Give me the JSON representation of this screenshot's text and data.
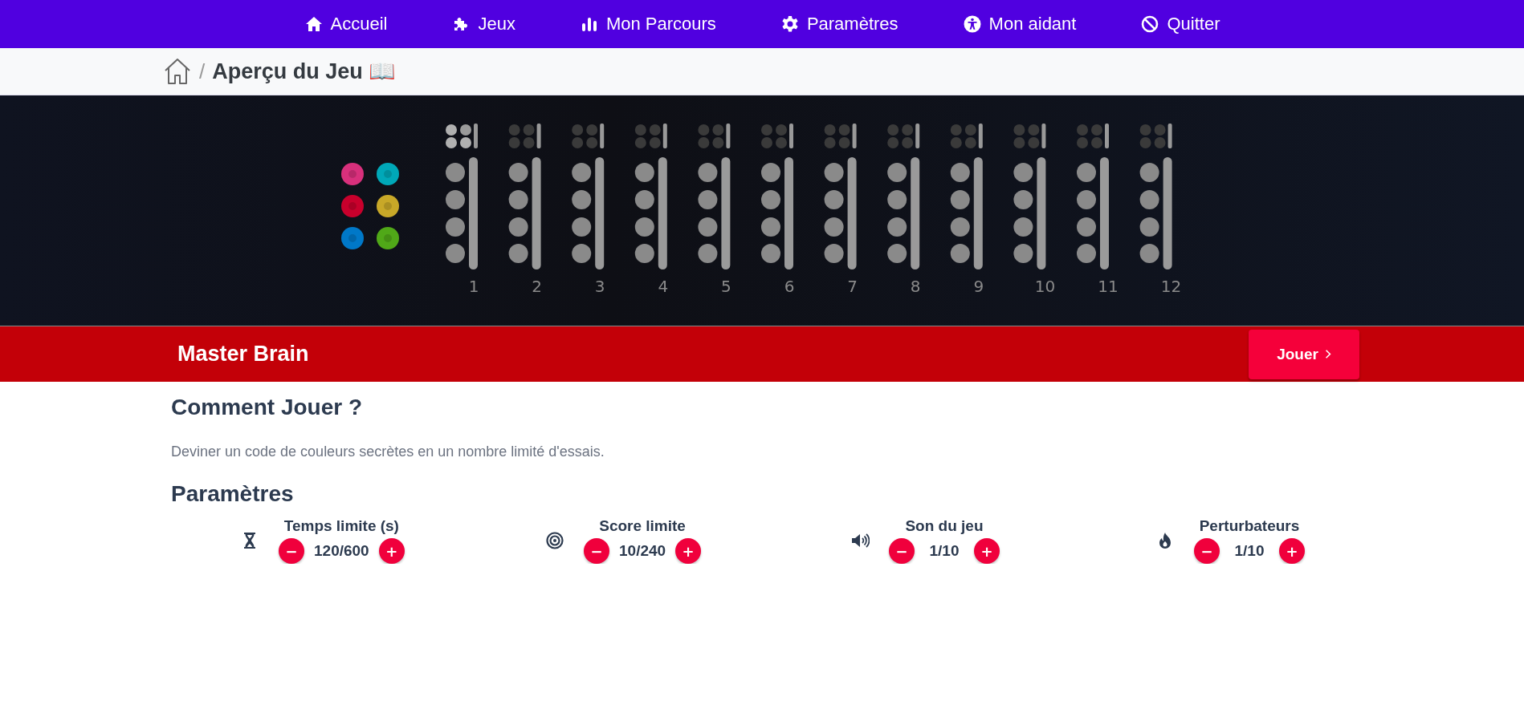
{
  "nav": [
    {
      "kind": "home",
      "label": "Accueil"
    },
    {
      "kind": "puzzle",
      "label": "Jeux"
    },
    {
      "kind": "chart",
      "label": "Mon Parcours"
    },
    {
      "kind": "gear",
      "label": "Paramètres"
    },
    {
      "kind": "person",
      "label": "Mon aidant"
    },
    {
      "kind": "ban",
      "label": "Quitter"
    }
  ],
  "breadcrumb": {
    "separator": "/",
    "title": "Aperçu du Jeu 📖"
  },
  "board": {
    "colors": [
      {
        "color": "#d8307c"
      },
      {
        "color": "#00a8b8"
      },
      {
        "color": "#c8002c"
      },
      {
        "color": "#c8a828"
      },
      {
        "color": "#0078c8"
      },
      {
        "color": "#50a818"
      }
    ],
    "rows": [
      {
        "number": "1",
        "active": true
      },
      {
        "number": "2",
        "active": false
      },
      {
        "number": "3",
        "active": false
      },
      {
        "number": "4",
        "active": false
      },
      {
        "number": "5",
        "active": false
      },
      {
        "number": "6",
        "active": false
      },
      {
        "number": "7",
        "active": false
      },
      {
        "number": "8",
        "active": false
      },
      {
        "number": "9",
        "active": false
      },
      {
        "number": "10",
        "active": false
      },
      {
        "number": "11",
        "active": false
      },
      {
        "number": "12",
        "active": false
      }
    ]
  },
  "game": {
    "title": "Master Brain",
    "play_button": "Jouer"
  },
  "how_to": {
    "heading": "Comment Jouer ?",
    "text": "Deviner un code de couleurs secrètes en un nombre limité d'essais."
  },
  "settings": {
    "heading": "Paramètres",
    "items": [
      {
        "kind": "time",
        "label": "Temps limite (s)",
        "minus": "−",
        "value": "120/600",
        "plus": "+"
      },
      {
        "kind": "score",
        "label": "Score limite",
        "minus": "−",
        "value": "10/240",
        "plus": "+"
      },
      {
        "kind": "sound",
        "label": "Son du jeu",
        "minus": "−",
        "value": "1/10",
        "plus": "+"
      },
      {
        "kind": "disturb",
        "label": "Perturbateurs",
        "minus": "−",
        "value": "1/10",
        "plus": "+"
      }
    ]
  }
}
